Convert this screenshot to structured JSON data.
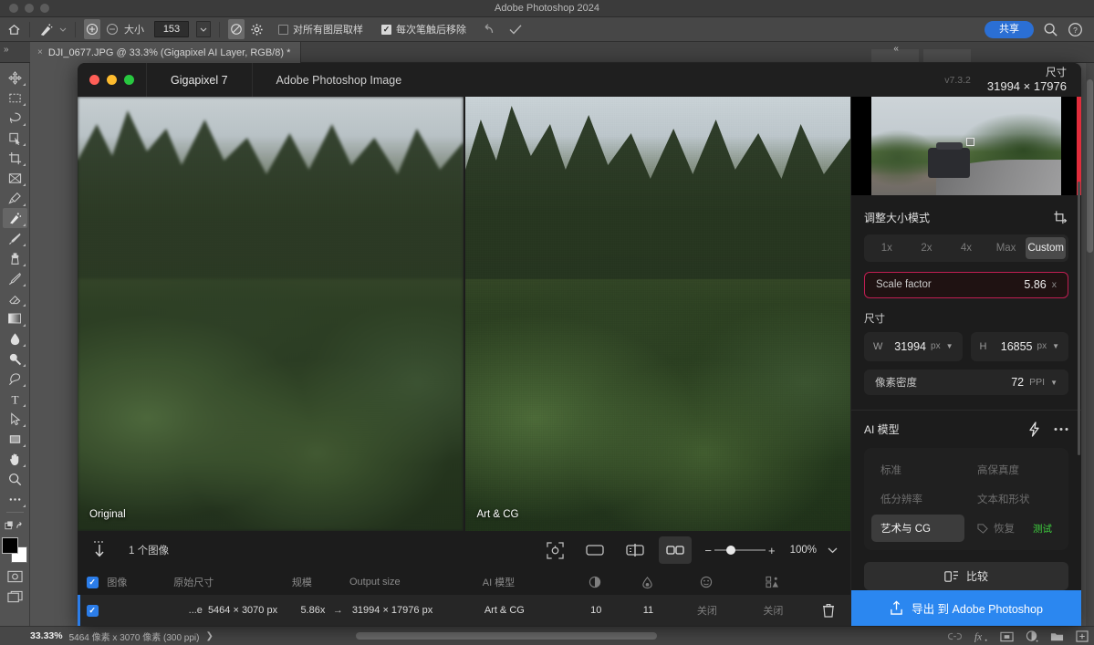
{
  "photoshop": {
    "app_title": "Adobe Photoshop 2024",
    "option_bar": {
      "brush_size_label": "大小",
      "brush_size_value": "153",
      "sample_all_layers_label": "对所有图层取样",
      "remove_after_stroke_label": "每次笔触后移除"
    },
    "share_label": "共享",
    "document_tab": {
      "title": "DJI_0677.JPG @ 33.3% (Gigapixel AI Layer, RGB/8) *",
      "close_label": "×"
    },
    "status_bar": {
      "zoom": "33.33%",
      "dimensions": "5464 像素 x 3070 像素 (300 ppi)",
      "chevron": "❯"
    },
    "tools": [
      {
        "name": "move-tool",
        "selected": false
      },
      {
        "name": "marquee-tool",
        "selected": false
      },
      {
        "name": "lasso-tool",
        "selected": false
      },
      {
        "name": "object-select-tool",
        "selected": false
      },
      {
        "name": "crop-tool",
        "selected": false
      },
      {
        "name": "frame-tool",
        "selected": false
      },
      {
        "name": "eyedropper-tool",
        "selected": false
      },
      {
        "name": "spot-healing-tool",
        "selected": true
      },
      {
        "name": "brush-tool",
        "selected": false
      },
      {
        "name": "clone-stamp-tool",
        "selected": false
      },
      {
        "name": "history-brush-tool",
        "selected": false
      },
      {
        "name": "eraser-tool",
        "selected": false
      },
      {
        "name": "gradient-tool",
        "selected": false
      },
      {
        "name": "blur-tool",
        "selected": false
      },
      {
        "name": "dodge-tool",
        "selected": false
      },
      {
        "name": "pen-tool",
        "selected": false
      },
      {
        "name": "type-tool",
        "selected": false
      },
      {
        "name": "path-selection-tool",
        "selected": false
      },
      {
        "name": "shape-tool",
        "selected": false
      },
      {
        "name": "hand-tool",
        "selected": false
      },
      {
        "name": "zoom-tool",
        "selected": false
      },
      {
        "name": "more-tools",
        "selected": false
      }
    ]
  },
  "gigapixel": {
    "titlebar": {
      "app_tab": "Gigapixel 7",
      "doc_tab": "Adobe Photoshop Image",
      "version": "v7.3.2",
      "dimension_label": "尺寸",
      "dimension_value": "31994 × 17976"
    },
    "previews": {
      "left_label": "Original",
      "right_label": "Art & CG"
    },
    "bottom_toolbar": {
      "image_count": "1 个图像",
      "zoom_value": "100%",
      "zoom_minus": "−",
      "zoom_plus": "+",
      "view_modes": [
        {
          "name": "fit-to-view-icon",
          "active": false
        },
        {
          "name": "single-view-icon",
          "active": false
        },
        {
          "name": "split-view-icon",
          "active": false
        },
        {
          "name": "side-by-side-view-icon",
          "active": true
        }
      ]
    },
    "table": {
      "headers": {
        "image": "图像",
        "original_size": "原始尺寸",
        "scale": "规模",
        "output_size": "Output size",
        "ai_model": "AI 模型"
      },
      "header_icons": [
        "denoise-icon",
        "sharpen-icon",
        "face-recovery-icon",
        "detail-icon"
      ],
      "rows": [
        {
          "checked": true,
          "name": "...e",
          "original_size": "5464 × 3070 px",
          "scale": "5.86x",
          "arrow": "→",
          "output_size": "31994 × 17976 px",
          "ai_model": "Art & CG",
          "denoise": "10",
          "sharpen": "11",
          "face_recovery": "关闭",
          "detail": "关闭"
        }
      ]
    },
    "right_panel": {
      "resize_mode_title": "调整大小模式",
      "crop_icon": "crop-rotate-icon",
      "presets": [
        {
          "label": "1x",
          "active": false
        },
        {
          "label": "2x",
          "active": false
        },
        {
          "label": "4x",
          "active": false
        },
        {
          "label": "Max",
          "active": false
        },
        {
          "label": "Custom",
          "active": true
        }
      ],
      "scale_factor": {
        "label": "Scale factor",
        "value": "5.86",
        "unit": "x"
      },
      "dimensions_label": "尺寸",
      "width": {
        "label": "W",
        "value": "31994",
        "unit": "px"
      },
      "height": {
        "label": "H",
        "value": "16855",
        "unit": "px"
      },
      "density": {
        "label": "像素密度",
        "value": "72",
        "unit": "PPI"
      },
      "ai_model_title": "AI 模型",
      "ai_model_icons": [
        "lightning-icon",
        "more-options-icon"
      ],
      "models": [
        {
          "label": "标准",
          "active": false
        },
        {
          "label": "高保真度",
          "active": false
        },
        {
          "label": "低分辨率",
          "active": false
        },
        {
          "label": "文本和形状",
          "active": false
        },
        {
          "label": "艺术与 CG",
          "active": true
        },
        {
          "label": "恢复",
          "active": false,
          "badge": "测试",
          "tag_icon": true
        }
      ],
      "compare_label": "比较",
      "export_label": "导出 到 Adobe Photoshop"
    }
  },
  "colors": {
    "accent_blue": "#2b87f0",
    "share_blue": "#2b6fd4",
    "scale_outline": "#c01e52",
    "beta_green": "#3fd43f",
    "panel_bg": "#1c1c1c",
    "ps_bg": "#535353"
  }
}
